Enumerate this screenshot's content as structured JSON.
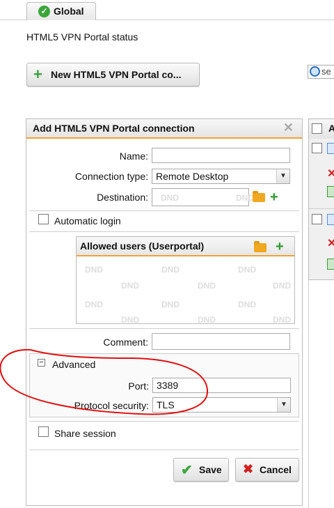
{
  "tab": {
    "label": "Global"
  },
  "status_title": "HTML5 VPN Portal status",
  "new_button": {
    "label": "New HTML5 VPN Portal co..."
  },
  "search": {
    "value": "se"
  },
  "dialog": {
    "title": "Add HTML5 VPN Portal connection",
    "fields": {
      "name_label": "Name:",
      "name_value": "",
      "conn_type_label": "Connection type:",
      "conn_type_value": "Remote Desktop",
      "destination_label": "Destination:",
      "dnd_text": "DND",
      "automatic_login_label": "Automatic login",
      "allowed_users_title": "Allowed users (Userportal)",
      "comment_label": "Comment:",
      "comment_value": "",
      "advanced_label": "Advanced",
      "port_label": "Port:",
      "port_value": "3389",
      "protocol_label": "Protocol security:",
      "protocol_value": "TLS",
      "share_session_label": "Share session"
    },
    "buttons": {
      "save": "Save",
      "cancel": "Cancel"
    }
  },
  "right_panel": {
    "header_letter": "A"
  },
  "colors": {
    "accent_orange": "#f1a232",
    "green": "#3aa63a",
    "red_annotation": "#e01010",
    "cancel_red": "#d42020"
  }
}
